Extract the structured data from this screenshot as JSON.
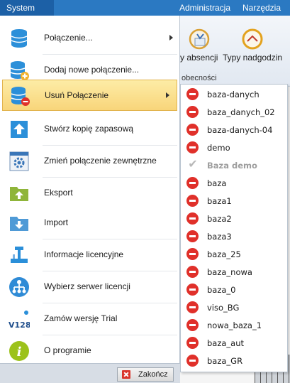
{
  "ribbon": {
    "system_tab": "System",
    "tabs": [
      "Administracja",
      "Narzędzia"
    ],
    "buttons": [
      "y absencji",
      "Typy nadgodzin"
    ],
    "group_label": "obecności"
  },
  "menu": {
    "items": [
      {
        "label": "Połączenie...",
        "icon": "database-icon",
        "has_submenu": true
      },
      {
        "label": "Dodaj nowe połączenie...",
        "icon": "database-add-icon",
        "has_submenu": false
      },
      {
        "label": "Usuń Połączenie",
        "icon": "database-remove-icon",
        "has_submenu": true,
        "selected": true
      },
      {
        "label": "Stwórz kopię zapasową",
        "icon": "backup-upload-icon",
        "has_submenu": false
      },
      {
        "label": "Zmień połączenie zewnętrzne",
        "icon": "gear-window-icon",
        "has_submenu": false
      },
      {
        "label": "Eksport",
        "icon": "folder-export-icon",
        "has_submenu": false
      },
      {
        "label": "Import",
        "icon": "folder-import-icon",
        "has_submenu": false
      },
      {
        "label": "Informacje licencyjne",
        "icon": "license-info-icon",
        "has_submenu": false
      },
      {
        "label": "Wybierz serwer licencji",
        "icon": "license-server-icon",
        "has_submenu": false
      },
      {
        "label": "Zamów wersję Trial",
        "icon": "trial-v128-icon",
        "has_submenu": false
      },
      {
        "label": "O programie",
        "icon": "info-icon",
        "has_submenu": false
      }
    ],
    "close_label": "Zakończ",
    "v128_text": "V128",
    "info_glyph": "i"
  },
  "submenu": {
    "items": [
      {
        "label": "baza-danych",
        "disabled": false
      },
      {
        "label": "baza_danych_02",
        "disabled": false
      },
      {
        "label": "baza-danych-04",
        "disabled": false
      },
      {
        "label": "demo",
        "disabled": false
      },
      {
        "label": "Baza demo",
        "disabled": true
      },
      {
        "label": "baza",
        "disabled": false
      },
      {
        "label": "baza1",
        "disabled": false
      },
      {
        "label": "baza2",
        "disabled": false
      },
      {
        "label": "baza3",
        "disabled": false
      },
      {
        "label": "baza_25",
        "disabled": false
      },
      {
        "label": "baza_nowa",
        "disabled": false
      },
      {
        "label": "baza_0",
        "disabled": false
      },
      {
        "label": "viso_BG",
        "disabled": false
      },
      {
        "label": "nowa_baza_1",
        "disabled": false
      },
      {
        "label": "baza_aut",
        "disabled": false
      },
      {
        "label": "baza_GR",
        "disabled": false
      }
    ]
  },
  "colors": {
    "ribbon_blue": "#2b79c2",
    "selected_highlight": "#f8d57a",
    "delete_red": "#e0302a"
  }
}
